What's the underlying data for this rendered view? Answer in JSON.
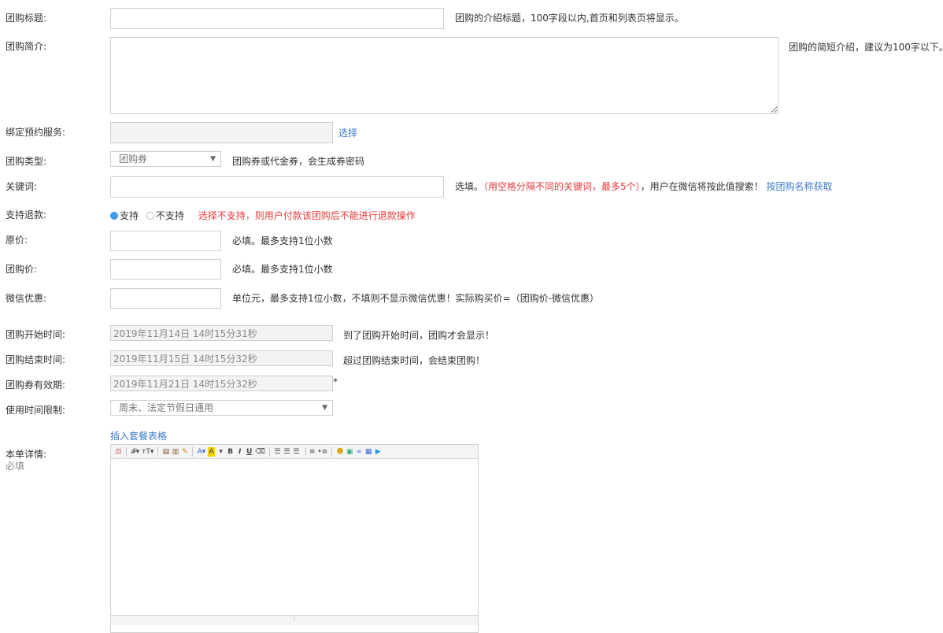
{
  "form": {
    "title": {
      "label": "团购标题:",
      "value": "",
      "hint": "团购的介绍标题，100字段以内,首页和列表页将显示。"
    },
    "intro": {
      "label": "团购简介:",
      "value": "",
      "hint": "团购的简短介绍，建议为100字以下。"
    },
    "booking": {
      "label": "绑定预约服务:",
      "value": "",
      "link": "选择"
    },
    "type": {
      "label": "团购类型:",
      "selected": "团购券",
      "hint": "团购券或代金券，会生成券密码"
    },
    "keywords": {
      "label": "关键词:",
      "value": "",
      "hint_prefix": "选填。",
      "hint_red": "（用空格分隔不同的关键词，最多5个）",
      "hint_suffix": "，用户在微信将按此值搜索！",
      "link": "按团购名称获取"
    },
    "refund": {
      "label": "支持退款:",
      "option_yes": "支持",
      "option_no": "不支持",
      "selected": "支持",
      "warning": "选择不支持，则用户付款该团购后不能进行退款操作"
    },
    "original_price": {
      "label": "原价:",
      "value": "",
      "hint": "必填。最多支持1位小数"
    },
    "group_price": {
      "label": "团购价:",
      "value": "",
      "hint": "必填。最多支持1位小数"
    },
    "wechat_discount": {
      "label": "微信优惠:",
      "value": "",
      "hint": "单位元，最多支持1位小数，不填则不显示微信优惠！实际购买价=（团购价-微信优惠）"
    },
    "start_time": {
      "label": "团购开始时间:",
      "value": "2019年11月14日 14时15分31秒",
      "hint": "到了团购开始时间，团购才会显示！"
    },
    "end_time": {
      "label": "团购结束时间:",
      "value": "2019年11月15日 14时15分32秒",
      "hint": "超过团购结束时间，会结束团购！"
    },
    "valid_until": {
      "label": "团购券有效期:",
      "value": "2019年11月21日 14时15分32秒",
      "required_mark": "*"
    },
    "time_limit": {
      "label": "使用时间限制:",
      "selected": "周末、法定节假日通用"
    },
    "insert_table_link": "插入套餐表格",
    "details": {
      "label": "本单详情:",
      "sublabel": "必填"
    }
  },
  "editor": {
    "toolbar_icons": [
      "source-icon",
      "font-family-icon",
      "font-size-icon",
      "paste-icon",
      "paste-text-icon",
      "format-brush-icon",
      "font-color-icon",
      "background-color-icon",
      "bold-icon",
      "italic-icon",
      "underline-icon",
      "remove-format-icon",
      "align-left-icon",
      "align-center-icon",
      "align-right-icon",
      "ordered-list-icon",
      "unordered-list-icon",
      "emoticon-icon",
      "image-icon",
      "link-icon",
      "table-icon",
      "video-icon"
    ],
    "content": ""
  },
  "colors": {
    "accent": "#3a7ac8",
    "warning": "#e4393c",
    "radio_on": "#3d9be9"
  }
}
